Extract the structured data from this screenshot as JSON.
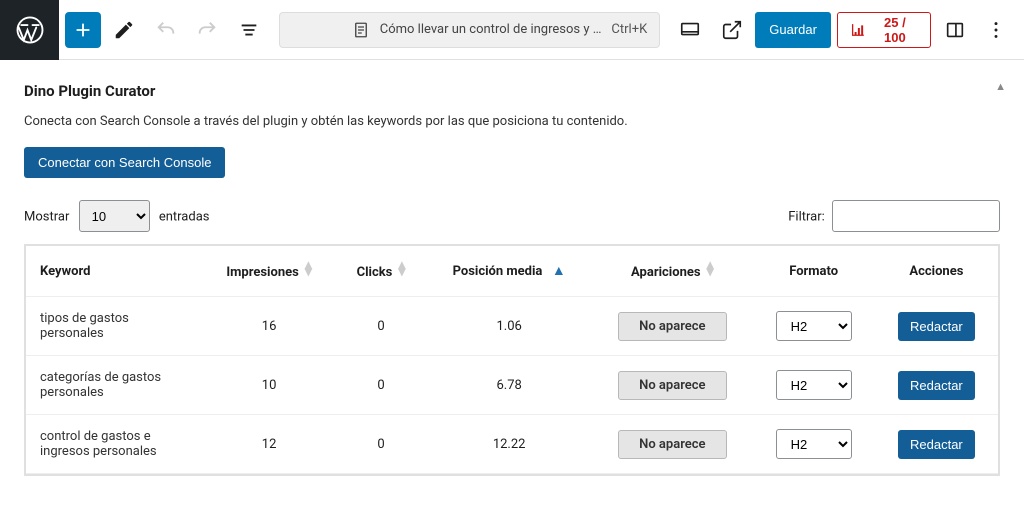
{
  "topbar": {
    "doc_title": "Cómo llevar un control de ingresos y …",
    "shortcut": "Ctrl+K",
    "save_label": "Guardar",
    "score": "25 / 100"
  },
  "panel": {
    "title": "Dino Plugin Curator",
    "description": "Conecta con Search Console a través del plugin y obtén las keywords por las que posiciona tu contenido.",
    "connect_label": "Conectar con Search Console"
  },
  "controls": {
    "show_label": "Mostrar",
    "entries_label": "entradas",
    "entries_value": "10",
    "filter_label": "Filtrar:",
    "filter_value": ""
  },
  "table": {
    "headers": {
      "keyword": "Keyword",
      "impresiones": "Impresiones",
      "clicks": "Clicks",
      "posicion": "Posición media",
      "apariciones": "Apariciones",
      "formato": "Formato",
      "acciones": "Acciones"
    },
    "badge_label": "No aparece",
    "format_value": "H2",
    "action_label": "Redactar",
    "rows": [
      {
        "keyword": "tipos de gastos personales",
        "impresiones": "16",
        "clicks": "0",
        "posicion": "1.06"
      },
      {
        "keyword": "categorías de gastos personales",
        "impresiones": "10",
        "clicks": "0",
        "posicion": "6.78"
      },
      {
        "keyword": "control de gastos e ingresos personales",
        "impresiones": "12",
        "clicks": "0",
        "posicion": "12.22"
      }
    ]
  }
}
